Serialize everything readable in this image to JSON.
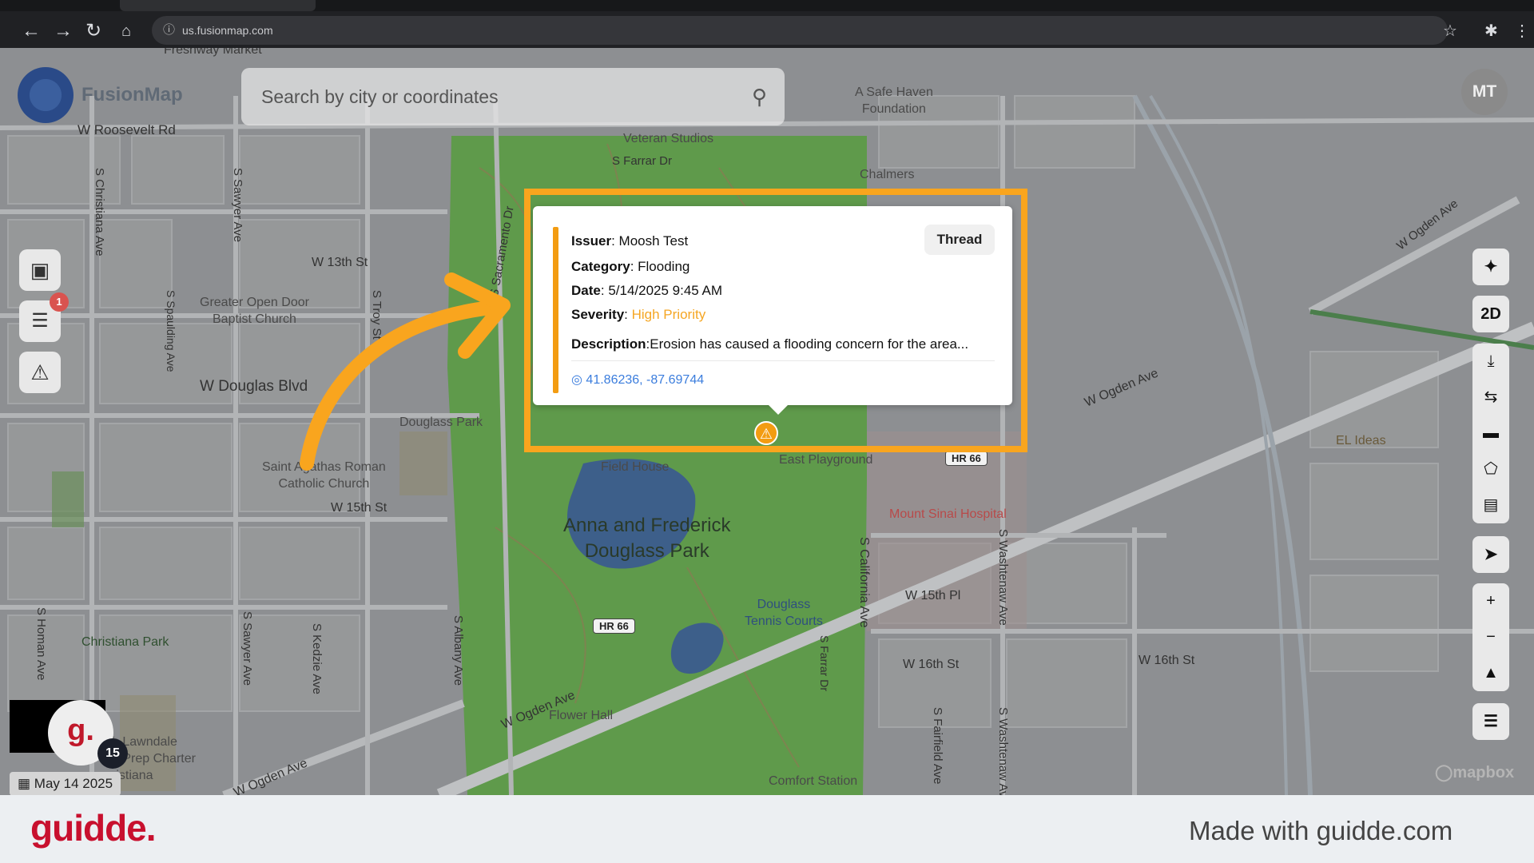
{
  "browser": {
    "url": "us.fusionmap.com",
    "icons": [
      "back-icon",
      "forward-icon",
      "reload-icon",
      "home-icon",
      "star-icon",
      "extension-icon",
      "menu-icon"
    ]
  },
  "app": {
    "logo_text": "FusionMap",
    "search_placeholder": "Search by city or coordinates",
    "user_initials": "MT",
    "notification_count": "1",
    "view_mode_label": "2D"
  },
  "map_labels": {
    "streets": {
      "roosevelt": "W Roosevelt Rd",
      "thirteenth": "W 13th St",
      "douglas_blvd": "W Douglas Blvd",
      "fifteenth": "W 15th St",
      "farrar": "S Farrar Dr",
      "ogden1": "W Ogden Ave",
      "ogden2": "W Ogden Ave",
      "ogden3": "W Ogden Ave",
      "ogden4": "W Ogden Ave",
      "fifteenth_pl": "W 15th Pl",
      "sixteenth1": "W 16th St",
      "sixteenth2": "W 16th St",
      "christiana": "S Christiana Ave",
      "sawyer1": "S Sawyer Ave",
      "spaulding": "S Spaulding Ave",
      "troy": "S Troy St",
      "sacramento": "S Sacramento Dr",
      "homan": "S Homan Ave",
      "sawyer2": "S Sawyer Ave",
      "kedzie": "S Kedzie Ave",
      "albany": "S Albany Ave",
      "california": "S California Ave",
      "washtenaw1": "S Washtenaw Ave",
      "washtenaw2": "S Washtenaw Ave",
      "fairfield": "S Fairfield Ave",
      "farrar2": "S Farrar Dr"
    },
    "pois": {
      "safe_haven": "A Safe Haven\nFoundation",
      "veteran": "Veteran Studios",
      "chalmers": "Chalmers",
      "greater_open_door": "Greater Open Door\nBaptist Church",
      "douglass_park": "Douglass Park",
      "saint_agathas": "Saint Agathas Roman\nCatholic Church",
      "field_house": "Field House",
      "east_playground": "East Playground",
      "mount_sinai": "Mount Sinai Hospital",
      "el_ideas": "EL Ideas",
      "douglass_tennis": "Douglass\nTennis Courts",
      "christiana_park": "Christiana Park",
      "lawndale": "h Lawndale\ne Prep Charter\nristiana",
      "flower_hall": "Flower Hall",
      "comfort_station": "Comfort Station",
      "freshway": "Freshway Market"
    },
    "park_title": "Anna and Frederick\nDouglass Park",
    "shields": [
      "HR 66",
      "HR 66"
    ]
  },
  "popup": {
    "issuer_label": "Issuer",
    "issuer_value": "Moosh Test",
    "category_label": "Category",
    "category_value": "Flooding",
    "date_label": "Date",
    "date_value": "5/14/2025 9:45 AM",
    "severity_label": "Severity",
    "severity_value": "High Priority",
    "description_label": "Description",
    "description_value": "Erosion has caused a flooding concern for the area...",
    "coordinates": "41.86236, -87.69744",
    "thread_button": "Thread",
    "colors": {
      "accent": "#f39c12",
      "priority": "#f5a623",
      "coords": "#3b7ddd"
    }
  },
  "bottom": {
    "user_count": "15",
    "date_chip": "May 14 2025",
    "mapbox_attribution": "mapbox"
  },
  "footer": {
    "brand": "guidde.",
    "made_with": "Made with guidde.com",
    "brand_color": "#c8102e"
  },
  "annotation_color": "#f9a51e"
}
